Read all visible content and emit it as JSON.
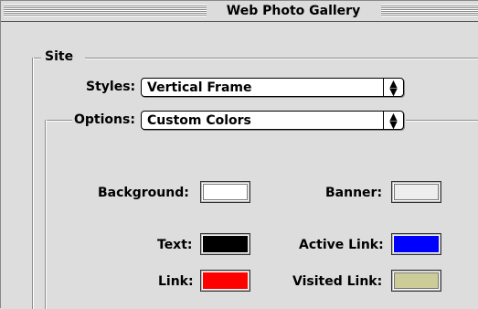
{
  "window": {
    "title": "Web Photo Gallery"
  },
  "site_group": {
    "label": "Site"
  },
  "styles": {
    "label": "Styles:",
    "value": "Vertical Frame"
  },
  "options": {
    "label": "Options:",
    "value": "Custom Colors"
  },
  "colors": {
    "background": {
      "label": "Background:",
      "color": "#ffffff"
    },
    "banner": {
      "label": "Banner:",
      "color": "#eeeeee"
    },
    "text": {
      "label": "Text:",
      "color": "#000000"
    },
    "active_link": {
      "label": "Active Link:",
      "color": "#0000ff"
    },
    "link": {
      "label": "Link:",
      "color": "#ff0000"
    },
    "visited_link": {
      "label": "Visited Link:",
      "color": "#cccc99"
    }
  },
  "icons": {
    "popup_arrows": "up-down-arrows-icon"
  }
}
